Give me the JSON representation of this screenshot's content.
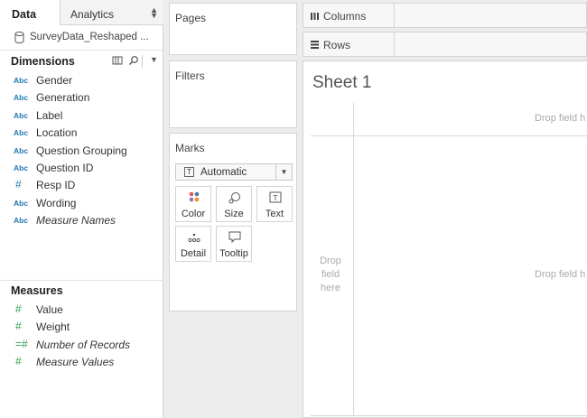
{
  "data_pane": {
    "tabs": {
      "data": "Data",
      "analytics": "Analytics"
    },
    "datasource": "SurveyData_Reshaped ...",
    "dimensions_title": "Dimensions",
    "dimensions": [
      {
        "type": "Abc",
        "label": "Gender"
      },
      {
        "type": "Abc",
        "label": "Generation"
      },
      {
        "type": "Abc",
        "label": "Label"
      },
      {
        "type": "Abc",
        "label": "Location"
      },
      {
        "type": "Abc",
        "label": "Question Grouping"
      },
      {
        "type": "Abc",
        "label": "Question ID"
      },
      {
        "type": "#",
        "label": "Resp ID"
      },
      {
        "type": "Abc",
        "label": "Wording"
      },
      {
        "type": "Abc",
        "label": "Measure Names"
      }
    ],
    "measures_title": "Measures",
    "measures": [
      {
        "type": "#",
        "label": "Value"
      },
      {
        "type": "#",
        "label": "Weight"
      },
      {
        "type": "=#",
        "label": "Number of Records"
      },
      {
        "type": "#",
        "label": "Measure Values"
      }
    ]
  },
  "shelves": {
    "pages": "Pages",
    "filters": "Filters",
    "marks": "Marks",
    "mark_type": "Automatic",
    "mark_type_icon": "T",
    "mark_buttons": {
      "color": "Color",
      "size": "Size",
      "text": "Text",
      "detail": "Detail",
      "tooltip": "Tooltip"
    },
    "columns": "Columns",
    "rows": "Rows"
  },
  "canvas": {
    "sheet_title": "Sheet 1",
    "drop_top": "Drop field h",
    "drop_center": "Drop field h",
    "drop_left": [
      "Drop",
      "field",
      "here"
    ]
  },
  "colors": {
    "dim_icon": "#1f77b4",
    "measure_icon": "#2a9d4a"
  }
}
